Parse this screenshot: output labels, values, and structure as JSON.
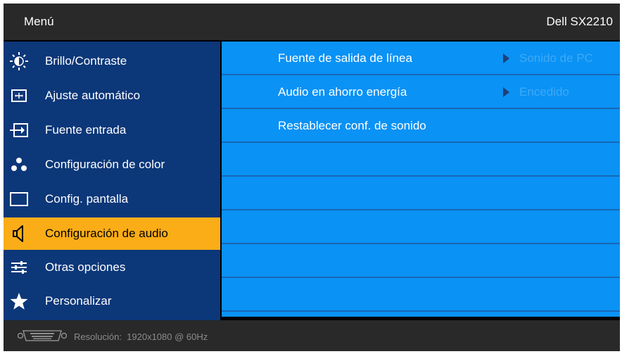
{
  "header": {
    "title": "Menú",
    "model": "Dell SX2210"
  },
  "sidebar": {
    "items": [
      {
        "label": "Brillo/Contraste",
        "icon": "brightness-icon"
      },
      {
        "label": "Ajuste automático",
        "icon": "auto-adjust-icon"
      },
      {
        "label": "Fuente entrada",
        "icon": "input-source-icon"
      },
      {
        "label": "Configuración de color",
        "icon": "color-dots-icon"
      },
      {
        "label": "Config. pantalla",
        "icon": "display-icon"
      },
      {
        "label": "Configuración de audio",
        "icon": "speaker-icon",
        "selected": true
      },
      {
        "label": "Otras opciones",
        "icon": "sliders-icon"
      },
      {
        "label": "Personalizar",
        "icon": "star-icon"
      }
    ]
  },
  "panel": {
    "rows": [
      {
        "label": "Fuente de salida de línea",
        "value": "Sonido de PC"
      },
      {
        "label": "Audio en ahorro energía",
        "value": "Encedido"
      },
      {
        "label": "Restablecer conf. de sonido"
      }
    ]
  },
  "status": {
    "resolution": "Resolución:  1920x1080 @ 60Hz",
    "icon": "vga-connector-icon"
  },
  "colors": {
    "sidebar": "#0c3779",
    "panel": "#0a92f5",
    "selected": "#fbad17",
    "title_bar": "#292929",
    "value_text": "#3fa9f5"
  }
}
